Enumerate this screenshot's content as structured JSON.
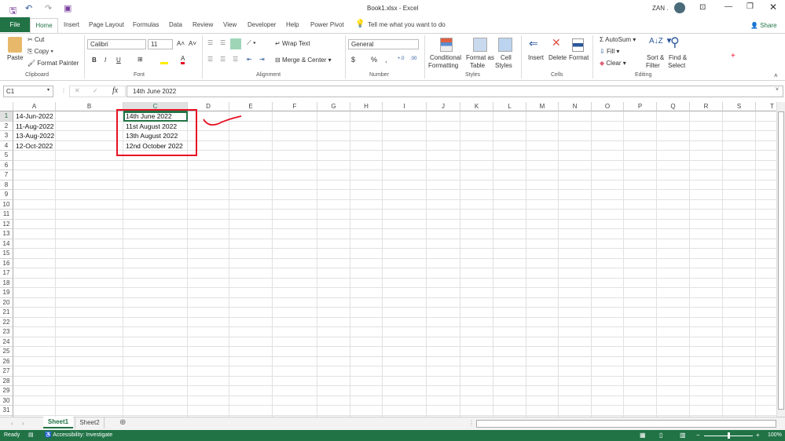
{
  "title": "Book1.xlsx  -  Excel",
  "user": "ZAN .",
  "tabs": [
    "File",
    "Home",
    "Insert",
    "Page Layout",
    "Formulas",
    "Data",
    "Review",
    "View",
    "Developer",
    "Help",
    "Power Pivot"
  ],
  "tell_me": "Tell me what you want to do",
  "share": "Share",
  "clipboard": {
    "paste": "Paste",
    "cut": "Cut",
    "copy": "Copy",
    "format_painter": "Format Painter",
    "label": "Clipboard"
  },
  "font": {
    "name": "Calibri",
    "size": "11",
    "bold": "B",
    "italic": "I",
    "underline": "U",
    "label": "Font"
  },
  "alignment": {
    "wrap": "Wrap Text",
    "merge": "Merge & Center",
    "label": "Alignment"
  },
  "number": {
    "format": "General",
    "currency": "$",
    "percent": "%",
    "comma": ",",
    "label": "Number"
  },
  "styles": {
    "conditional": "Conditional",
    "formatting": "Formatting",
    "format_as": "Format as",
    "table": "Table",
    "cell": "Cell",
    "cell_styles": "Styles",
    "label": "Styles"
  },
  "cells": {
    "insert": "Insert",
    "delete": "Delete",
    "format": "Format",
    "label": "Cells"
  },
  "editing": {
    "autosum": "AutoSum",
    "fill": "Fill",
    "clear": "Clear",
    "sort": "Sort &",
    "filter": "Filter",
    "find": "Find &",
    "select": "Select",
    "label": "Editing"
  },
  "formula_bar": {
    "name_box": "C1",
    "fx": "fx",
    "value": "14th June 2022"
  },
  "columns": [
    "A",
    "B",
    "C",
    "D",
    "E",
    "F",
    "G",
    "H",
    "I",
    "J",
    "K",
    "L",
    "M",
    "N",
    "O",
    "P",
    "Q",
    "R",
    "S",
    "T"
  ],
  "cells_data": {
    "A": [
      "14-Jun-2022",
      "11-Aug-2022",
      "13-Aug-2022",
      "12-Oct-2022"
    ],
    "C": [
      "14th June 2022",
      "11st August 2022",
      "13th August 2022",
      "12nd October 2022"
    ]
  },
  "sheets": [
    "Sheet1",
    "Sheet2"
  ],
  "status": {
    "ready": "Ready",
    "accessibility": "Accessibility: Investigate",
    "zoom": "100%"
  },
  "colors": {
    "accent": "#217346",
    "highlight": "#e81123"
  }
}
